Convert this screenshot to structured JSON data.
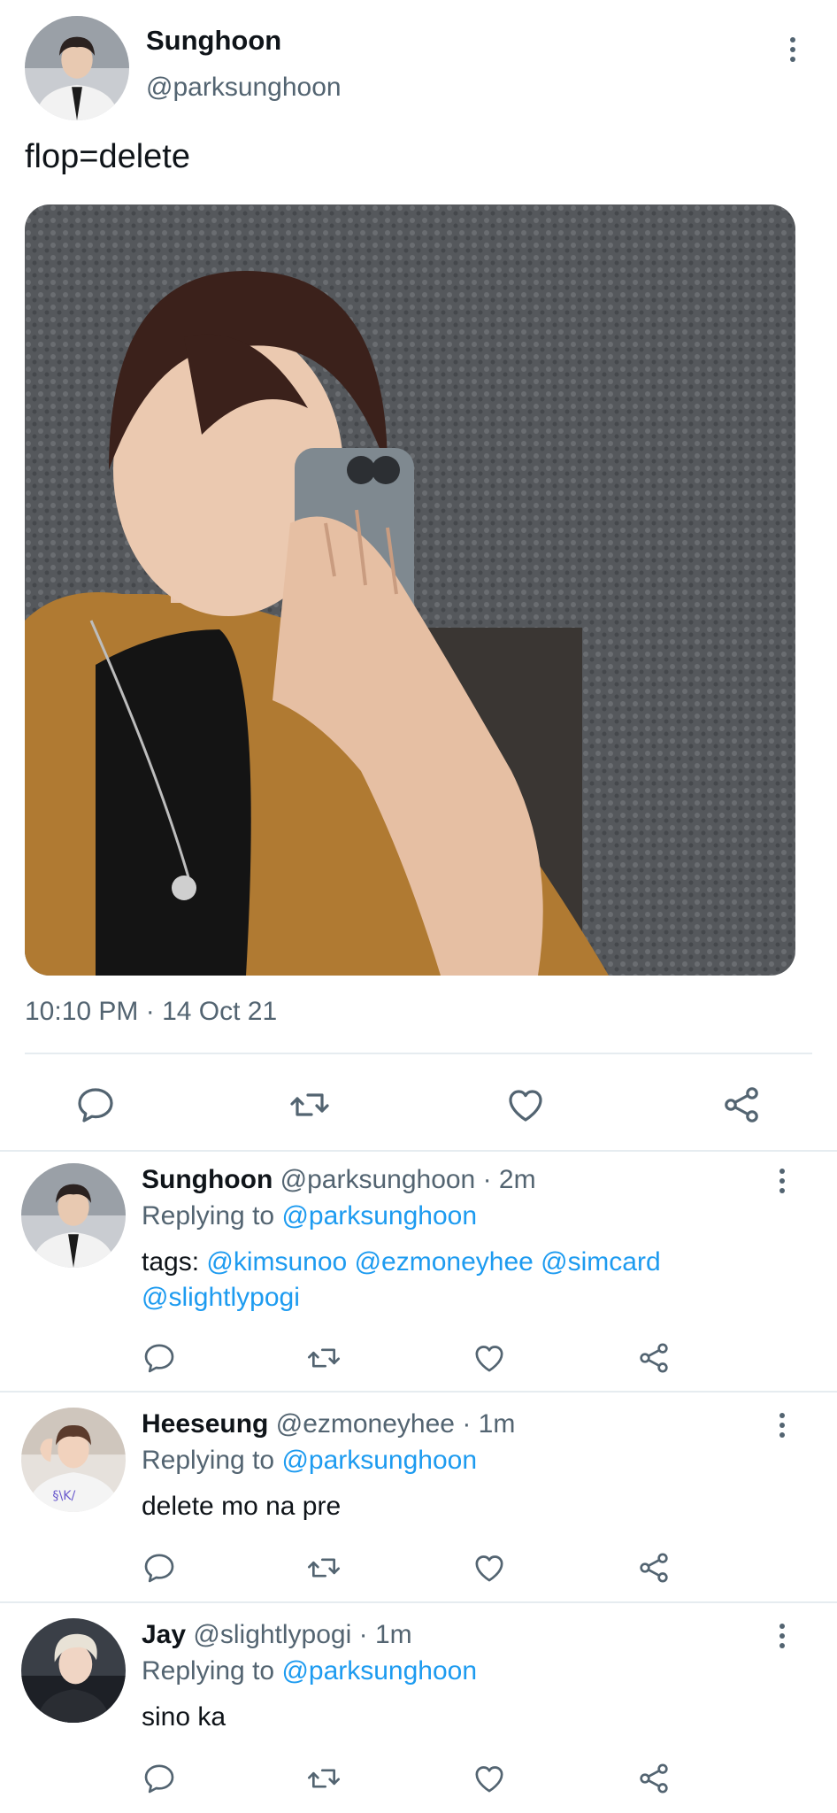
{
  "main_tweet": {
    "name": "Sunghoon",
    "handle": "@parksunghoon",
    "text": "flop=delete",
    "timestamp": "10:10 PM · 14 Oct 21",
    "avatar_icon": "user-avatar-sunghoon",
    "image_alt": "mirror selfie photo"
  },
  "replies": [
    {
      "name": "Sunghoon",
      "handle": "@parksunghoon",
      "time": "· 2m",
      "replying_label": "Replying to",
      "replying_to": "@parksunghoon",
      "text_prefix": "tags: ",
      "mentions": [
        "@kimsunoo",
        "@ezmoneyhee",
        "@simcard",
        "@slightlypogi"
      ]
    },
    {
      "name": "Heeseung",
      "handle": "@ezmoneyhee",
      "time": "· 1m",
      "replying_label": "Replying to",
      "replying_to": "@parksunghoon",
      "text": "delete mo na pre"
    },
    {
      "name": "Jay",
      "handle": "@slightlypogi",
      "time": "· 1m",
      "replying_label": "Replying to",
      "replying_to": "@parksunghoon",
      "text": "sino ka"
    }
  ],
  "icons": {
    "reply": "reply-icon",
    "retweet": "retweet-icon",
    "like": "heart-icon",
    "share": "share-icon",
    "more": "more-vertical-icon"
  },
  "colors": {
    "link": "#1d9bf0",
    "secondary_text": "#536471",
    "divider": "#e6ecf0"
  }
}
